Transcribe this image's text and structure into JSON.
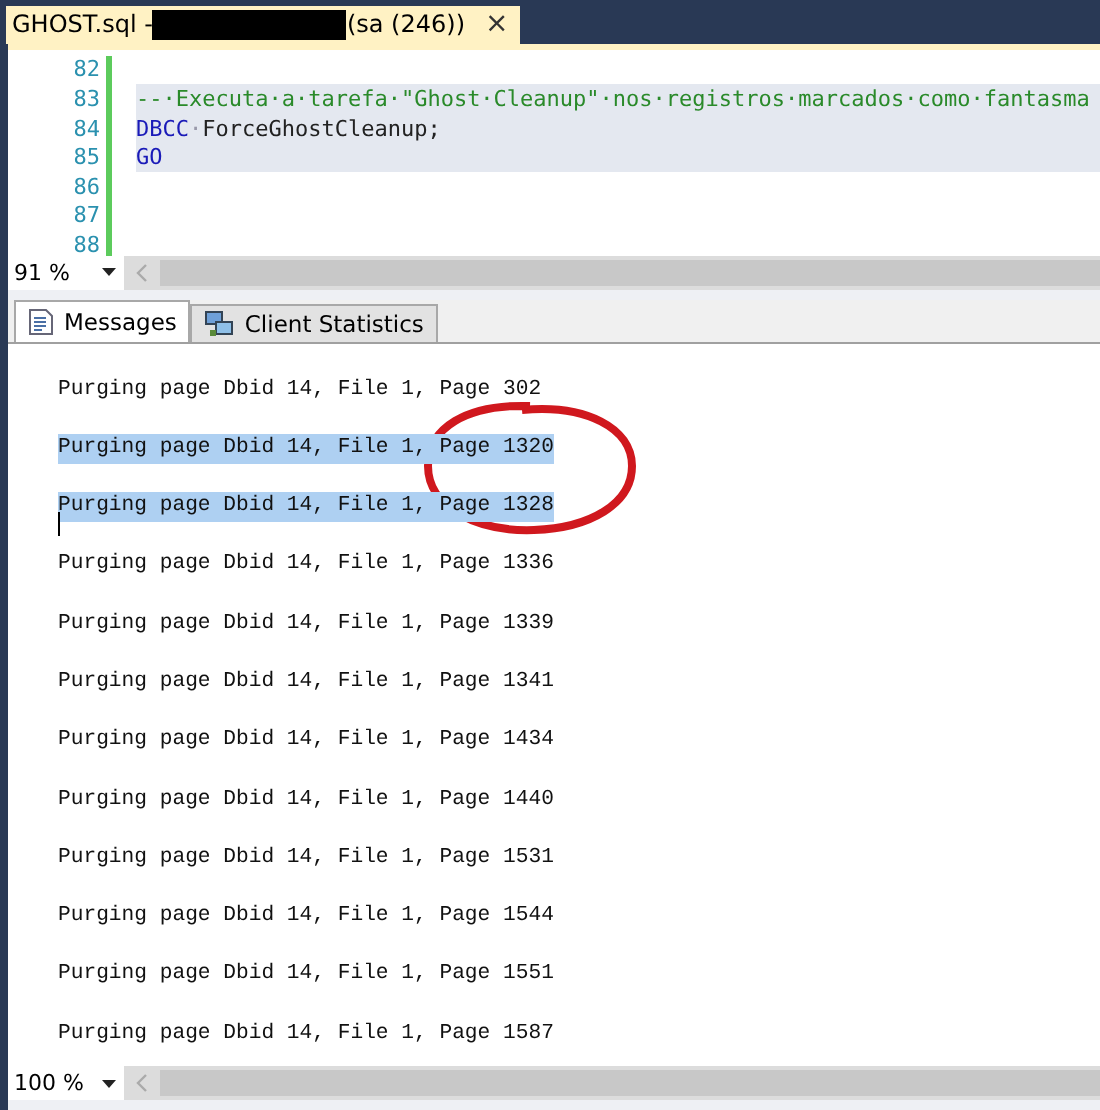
{
  "document_tab": {
    "title_start": "GHOST.sql - ",
    "title_end": "(sa (246))",
    "close": "×",
    "selected": true
  },
  "editor": {
    "lines": [
      {
        "number": "82",
        "highlighted": false
      },
      {
        "number": "83",
        "highlighted": true,
        "tokens": [
          {
            "kind": "comment",
            "text": "--·Executa·a·tarefa·\"Ghost·Cleanup\"·nos·registros·marcados·como·fantasma"
          }
        ]
      },
      {
        "number": "84",
        "highlighted": true,
        "tokens": [
          {
            "kind": "keyword",
            "text": "DBCC"
          },
          {
            "kind": "whitespace",
            "text": "·"
          },
          {
            "kind": "plain",
            "text": "ForceGhostCleanup;"
          }
        ]
      },
      {
        "number": "85",
        "highlighted": true,
        "tokens": [
          {
            "kind": "keyword",
            "text": "GO"
          }
        ]
      },
      {
        "number": "86",
        "highlighted": false
      },
      {
        "number": "87",
        "highlighted": false
      },
      {
        "number": "88",
        "highlighted": false
      }
    ],
    "zoom": "91 %"
  },
  "results_tabs": [
    {
      "label": "Messages",
      "selected": true,
      "kind": "messages"
    },
    {
      "label": "Client Statistics",
      "selected": false,
      "kind": "statistics"
    }
  ],
  "messages": [
    {
      "text": "Purging page Dbid 14, File 1, Page 302",
      "selected": false
    },
    {
      "text": "Purging page Dbid 14, File 1, Page 1320",
      "selected": true
    },
    {
      "text": "Purging page Dbid 14, File 1, Page 1328",
      "selected": true
    },
    {
      "text": "Purging page Dbid 14, File 1, Page 1336",
      "selected": false
    },
    {
      "text": "Purging page Dbid 14, File 1, Page 1339",
      "selected": false
    },
    {
      "text": "Purging page Dbid 14, File 1, Page 1341",
      "selected": false
    },
    {
      "text": "Purging page Dbid 14, File 1, Page 1434",
      "selected": false
    },
    {
      "text": "Purging page Dbid 14, File 1, Page 1440",
      "selected": false
    },
    {
      "text": "Purging page Dbid 14, File 1, Page 1531",
      "selected": false
    },
    {
      "text": "Purging page Dbid 14, File 1, Page 1544",
      "selected": false
    },
    {
      "text": "Purging page Dbid 14, File 1, Page 1551",
      "selected": false
    },
    {
      "text": "Purging page Dbid 14, File 1, Page 1587",
      "selected": false
    }
  ],
  "messages_zoom": "100 %"
}
